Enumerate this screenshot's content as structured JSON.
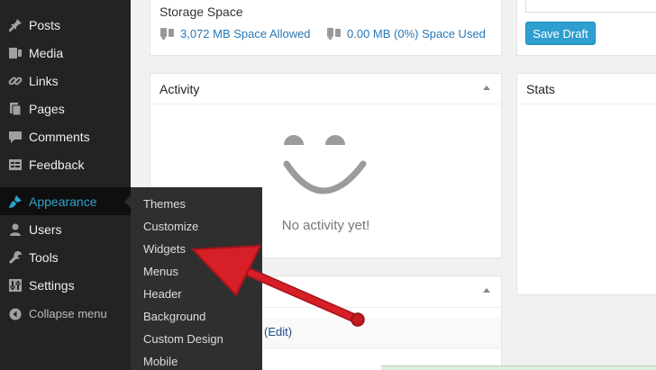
{
  "sidebar": {
    "items": [
      {
        "label": "Posts",
        "icon": "pin-icon"
      },
      {
        "label": "Media",
        "icon": "media-icon"
      },
      {
        "label": "Links",
        "icon": "link-icon"
      },
      {
        "label": "Pages",
        "icon": "pages-icon"
      },
      {
        "label": "Comments",
        "icon": "comment-icon"
      },
      {
        "label": "Feedback",
        "icon": "feedback-icon"
      },
      {
        "label": "Appearance",
        "icon": "brush-icon",
        "active": true
      },
      {
        "label": "Users",
        "icon": "user-icon"
      },
      {
        "label": "Tools",
        "icon": "wrench-icon"
      },
      {
        "label": "Settings",
        "icon": "settings-icon"
      }
    ],
    "collapse_label": "Collapse menu"
  },
  "appearance_submenu": {
    "items": [
      "Themes",
      "Customize",
      "Widgets",
      "Menus",
      "Header",
      "Background",
      "Custom Design",
      "Mobile"
    ]
  },
  "storage": {
    "title": "Storage Space",
    "allowed": "3,072 MB Space Allowed",
    "used": "0.00 MB (0%) Space Used"
  },
  "publish": {
    "save_draft_label": "Save Draft"
  },
  "activity": {
    "title": "Activity",
    "empty_message": "No activity yet!"
  },
  "stats": {
    "title": "Stats"
  },
  "lower_panel": {
    "edit_link": "(Edit)"
  },
  "colors": {
    "sidebar_bg": "#232323",
    "active_text": "#2ea2cc",
    "submenu_bg": "#2f2f2f",
    "button_bg": "#2e9fd0",
    "arrow": "#d61f26"
  }
}
